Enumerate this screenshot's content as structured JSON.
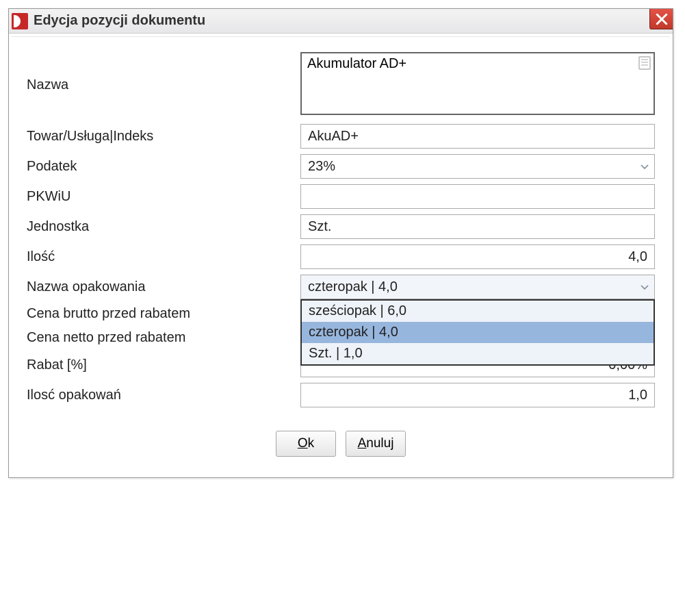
{
  "window": {
    "title": "Edycja pozycji dokumentu"
  },
  "labels": {
    "nazwa": "Nazwa",
    "towar_indeks": "Towar/Usługa|Indeks",
    "podatek": "Podatek",
    "pkwiu": "PKWiU",
    "jednostka": "Jednostka",
    "ilosc": "Ilość",
    "nazwa_opakowania": "Nazwa opakowania",
    "cena_brutto": "Cena brutto przed rabatem",
    "cena_netto": "Cena netto przed rabatem",
    "rabat": "Rabat [%]",
    "ilosc_opakowan": "Ilosć opakowań"
  },
  "fields": {
    "nazwa": "Akumulator AD+",
    "towar_indeks": "AkuAD+",
    "podatek": "23%",
    "pkwiu": "",
    "jednostka": "Szt.",
    "ilosc": "4,0",
    "nazwa_opakowania": "czteropak | 4,0",
    "rabat": "0,00%",
    "ilosc_opakowan": "1,0"
  },
  "dropdown": {
    "options": [
      {
        "label": "sześciopak | 6,0",
        "selected": false
      },
      {
        "label": "czteropak | 4,0",
        "selected": true
      },
      {
        "label": "Szt. | 1,0",
        "selected": false
      }
    ]
  },
  "buttons": {
    "ok_accel": "O",
    "ok_rest": "k",
    "cancel_accel": "A",
    "cancel_rest": "nuluj"
  }
}
